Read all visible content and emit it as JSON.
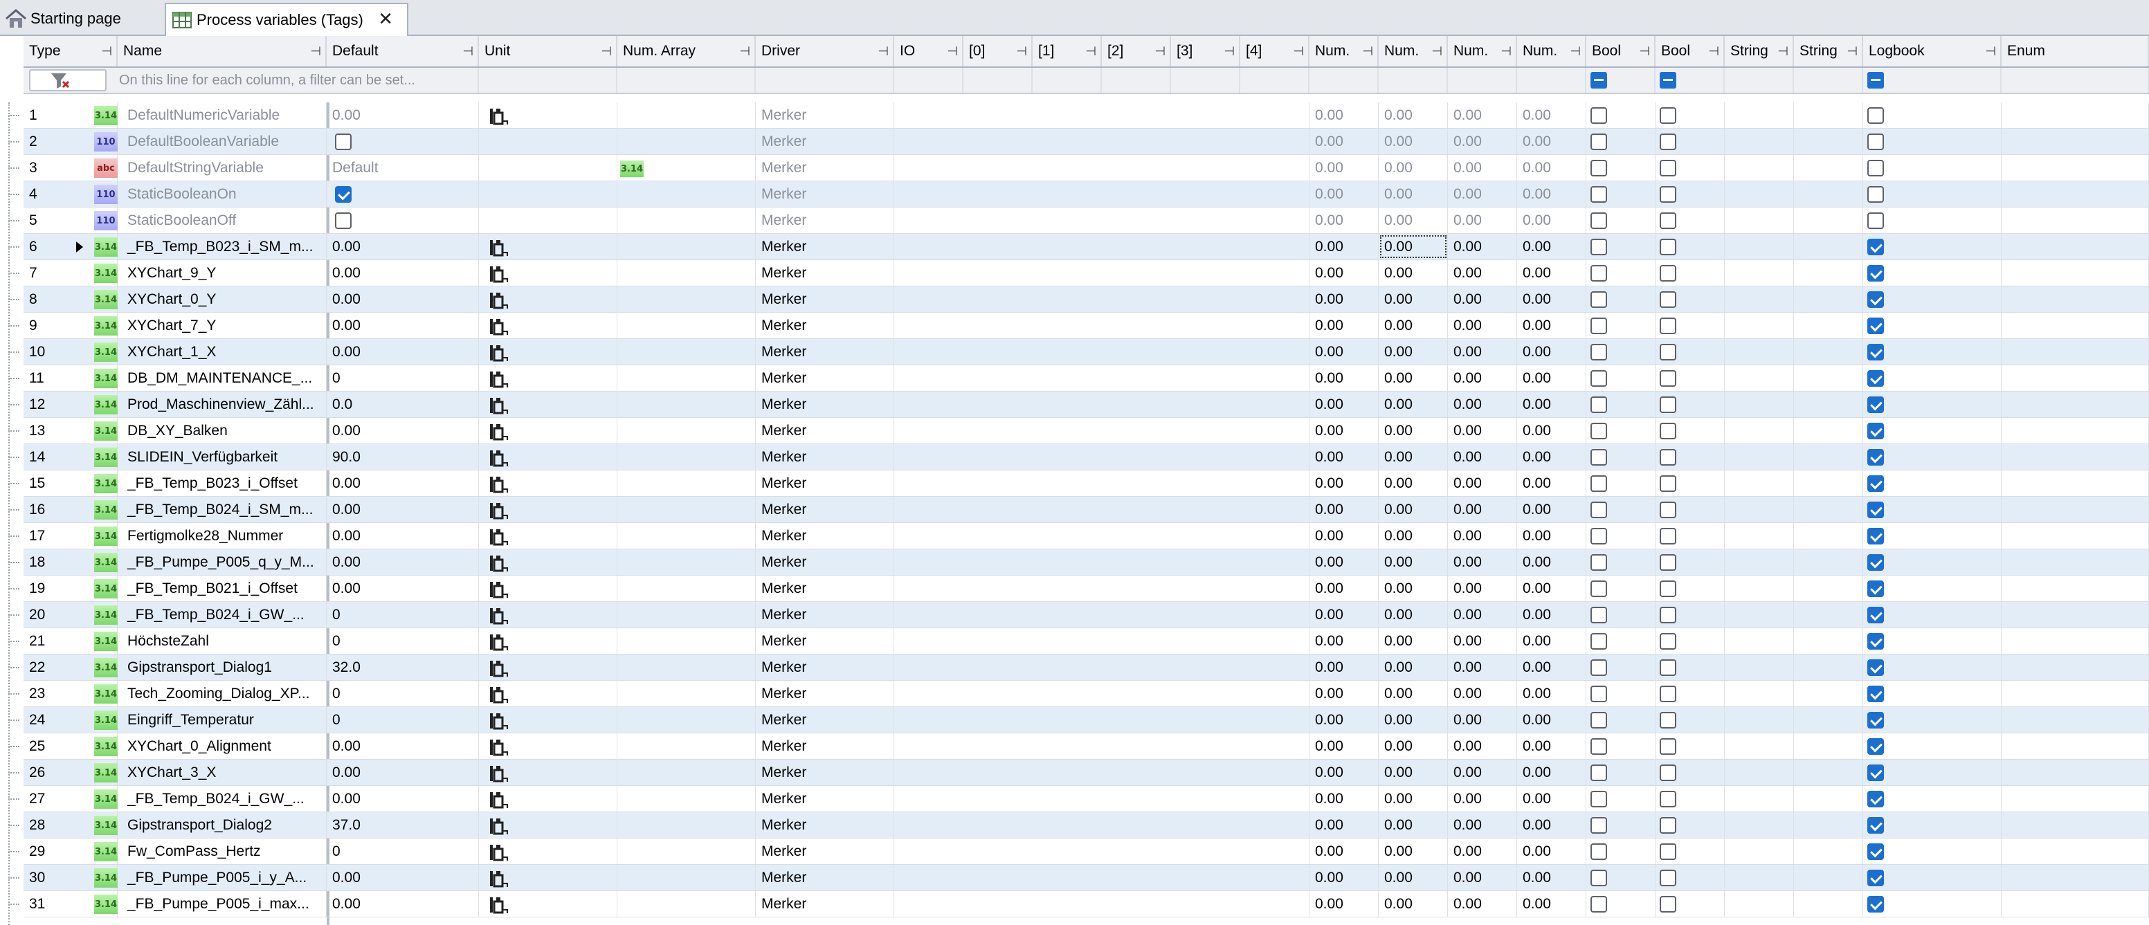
{
  "tabs": [
    {
      "label": "Starting page",
      "icon": "home-icon",
      "active": false
    },
    {
      "label": "Process variables (Tags)",
      "icon": "table-icon",
      "active": true,
      "close": "✕"
    }
  ],
  "columns": [
    {
      "key": "type",
      "label": "Type"
    },
    {
      "key": "name",
      "label": "Name"
    },
    {
      "key": "default",
      "label": "Default"
    },
    {
      "key": "unit",
      "label": "Unit"
    },
    {
      "key": "numarray",
      "label": "Num. Array"
    },
    {
      "key": "driver",
      "label": "Driver"
    },
    {
      "key": "io",
      "label": "IO"
    },
    {
      "key": "i0",
      "label": "[0]"
    },
    {
      "key": "i1",
      "label": "[1]"
    },
    {
      "key": "i2",
      "label": "[2]"
    },
    {
      "key": "i3",
      "label": "[3]"
    },
    {
      "key": "i4",
      "label": "[4]"
    },
    {
      "key": "num1",
      "label": "Num."
    },
    {
      "key": "num2",
      "label": "Num."
    },
    {
      "key": "num3",
      "label": "Num."
    },
    {
      "key": "num4",
      "label": "Num."
    },
    {
      "key": "bool1",
      "label": "Bool"
    },
    {
      "key": "bool2",
      "label": "Bool"
    },
    {
      "key": "string1",
      "label": "String"
    },
    {
      "key": "string2",
      "label": "String"
    },
    {
      "key": "logbook",
      "label": "Logbook"
    },
    {
      "key": "enum",
      "label": "Enum"
    }
  ],
  "filter_placeholder": "On this line for each column, a filter can be set...",
  "pin_glyph": "⊣",
  "rows": [
    {
      "id": "1",
      "type": "num",
      "badge": "3.14",
      "name": "DefaultNumericVariable",
      "default": "0.00",
      "unit_icon": true,
      "driver": "Merker",
      "n": [
        "0.00",
        "0.00",
        "0.00",
        "0.00"
      ],
      "b1": false,
      "b2": false,
      "log": false,
      "gray": true
    },
    {
      "id": "2",
      "type": "bool",
      "badge": "110",
      "name": "DefaultBooleanVariable",
      "default_cb": false,
      "driver": "Merker",
      "n": [
        "0.00",
        "0.00",
        "0.00",
        "0.00"
      ],
      "b1": false,
      "b2": false,
      "log": false,
      "gray": true
    },
    {
      "id": "3",
      "type": "str",
      "badge": "abc",
      "name": "DefaultStringVariable",
      "default": "Default",
      "numarray_badge": "3.14",
      "driver": "Merker",
      "n": [
        "0.00",
        "0.00",
        "0.00",
        "0.00"
      ],
      "b1": false,
      "b2": false,
      "log": false,
      "gray": true
    },
    {
      "id": "4",
      "type": "bool",
      "badge": "110",
      "name": "StaticBooleanOn",
      "default_cb": true,
      "driver": "Merker",
      "n": [
        "0.00",
        "0.00",
        "0.00",
        "0.00"
      ],
      "b1": false,
      "b2": false,
      "log": false,
      "gray": true
    },
    {
      "id": "5",
      "type": "bool",
      "badge": "110",
      "name": "StaticBooleanOff",
      "default_cb": false,
      "driver": "Merker",
      "n": [
        "0.00",
        "0.00",
        "0.00",
        "0.00"
      ],
      "b1": false,
      "b2": false,
      "log": false,
      "gray": true
    },
    {
      "id": "6",
      "type": "num",
      "badge": "3.14",
      "name": "_FB_Temp_B023_i_SM_m...",
      "default": "0.00",
      "unit_icon": true,
      "driver": "Merker",
      "n": [
        "0.00",
        "0.00",
        "0.00",
        "0.00"
      ],
      "b1": false,
      "b2": false,
      "log": true,
      "selected": true
    },
    {
      "id": "7",
      "type": "num",
      "badge": "3.14",
      "name": "XYChart_9_Y",
      "default": "0.00",
      "unit_icon": true,
      "driver": "Merker",
      "n": [
        "0.00",
        "0.00",
        "0.00",
        "0.00"
      ],
      "b1": false,
      "b2": false,
      "log": true
    },
    {
      "id": "8",
      "type": "num",
      "badge": "3.14",
      "name": "XYChart_0_Y",
      "default": "0.00",
      "unit_icon": true,
      "driver": "Merker",
      "n": [
        "0.00",
        "0.00",
        "0.00",
        "0.00"
      ],
      "b1": false,
      "b2": false,
      "log": true
    },
    {
      "id": "9",
      "type": "num",
      "badge": "3.14",
      "name": "XYChart_7_Y",
      "default": "0.00",
      "unit_icon": true,
      "driver": "Merker",
      "n": [
        "0.00",
        "0.00",
        "0.00",
        "0.00"
      ],
      "b1": false,
      "b2": false,
      "log": true
    },
    {
      "id": "10",
      "type": "num",
      "badge": "3.14",
      "name": "XYChart_1_X",
      "default": "0.00",
      "unit_icon": true,
      "driver": "Merker",
      "n": [
        "0.00",
        "0.00",
        "0.00",
        "0.00"
      ],
      "b1": false,
      "b2": false,
      "log": true
    },
    {
      "id": "11",
      "type": "num",
      "badge": "3.14",
      "name": "DB_DM_MAINTENANCE_...",
      "default": "0",
      "unit_icon": true,
      "driver": "Merker",
      "n": [
        "0.00",
        "0.00",
        "0.00",
        "0.00"
      ],
      "b1": false,
      "b2": false,
      "log": true
    },
    {
      "id": "12",
      "type": "num",
      "badge": "3.14",
      "name": "Prod_Maschinenview_Zähl...",
      "default": "0.0",
      "unit_icon": true,
      "driver": "Merker",
      "n": [
        "0.00",
        "0.00",
        "0.00",
        "0.00"
      ],
      "b1": false,
      "b2": false,
      "log": true
    },
    {
      "id": "13",
      "type": "num",
      "badge": "3.14",
      "name": "DB_XY_Balken",
      "default": "0.00",
      "unit_icon": true,
      "driver": "Merker",
      "n": [
        "0.00",
        "0.00",
        "0.00",
        "0.00"
      ],
      "b1": false,
      "b2": false,
      "log": true
    },
    {
      "id": "14",
      "type": "num",
      "badge": "3.14",
      "name": "SLIDEIN_Verfügbarkeit",
      "default": "90.0",
      "unit_icon": true,
      "driver": "Merker",
      "n": [
        "0.00",
        "0.00",
        "0.00",
        "0.00"
      ],
      "b1": false,
      "b2": false,
      "log": true
    },
    {
      "id": "15",
      "type": "num",
      "badge": "3.14",
      "name": "_FB_Temp_B023_i_Offset",
      "default": "0.00",
      "unit_icon": true,
      "driver": "Merker",
      "n": [
        "0.00",
        "0.00",
        "0.00",
        "0.00"
      ],
      "b1": false,
      "b2": false,
      "log": true
    },
    {
      "id": "16",
      "type": "num",
      "badge": "3.14",
      "name": "_FB_Temp_B024_i_SM_m...",
      "default": "0.00",
      "unit_icon": true,
      "driver": "Merker",
      "n": [
        "0.00",
        "0.00",
        "0.00",
        "0.00"
      ],
      "b1": false,
      "b2": false,
      "log": true
    },
    {
      "id": "17",
      "type": "num",
      "badge": "3.14",
      "name": "Fertigmolke28_Nummer",
      "default": "0.00",
      "unit_icon": true,
      "driver": "Merker",
      "n": [
        "0.00",
        "0.00",
        "0.00",
        "0.00"
      ],
      "b1": false,
      "b2": false,
      "log": true
    },
    {
      "id": "18",
      "type": "num",
      "badge": "3.14",
      "name": "_FB_Pumpe_P005_q_y_M...",
      "default": "0.00",
      "unit_icon": true,
      "driver": "Merker",
      "n": [
        "0.00",
        "0.00",
        "0.00",
        "0.00"
      ],
      "b1": false,
      "b2": false,
      "log": true
    },
    {
      "id": "19",
      "type": "num",
      "badge": "3.14",
      "name": "_FB_Temp_B021_i_Offset",
      "default": "0.00",
      "unit_icon": true,
      "driver": "Merker",
      "n": [
        "0.00",
        "0.00",
        "0.00",
        "0.00"
      ],
      "b1": false,
      "b2": false,
      "log": true
    },
    {
      "id": "20",
      "type": "num",
      "badge": "3.14",
      "name": "_FB_Temp_B024_i_GW_...",
      "default": "0",
      "unit_icon": true,
      "driver": "Merker",
      "n": [
        "0.00",
        "0.00",
        "0.00",
        "0.00"
      ],
      "b1": false,
      "b2": false,
      "log": true
    },
    {
      "id": "21",
      "type": "num",
      "badge": "3.14",
      "name": "HöchsteZahl",
      "default": "0",
      "unit_icon": true,
      "driver": "Merker",
      "n": [
        "0.00",
        "0.00",
        "0.00",
        "0.00"
      ],
      "b1": false,
      "b2": false,
      "log": true
    },
    {
      "id": "22",
      "type": "num",
      "badge": "3.14",
      "name": "Gipstransport_Dialog1",
      "default": "32.0",
      "unit_icon": true,
      "driver": "Merker",
      "n": [
        "0.00",
        "0.00",
        "0.00",
        "0.00"
      ],
      "b1": false,
      "b2": false,
      "log": true
    },
    {
      "id": "23",
      "type": "num",
      "badge": "3.14",
      "name": "Tech_Zooming_Dialog_XP...",
      "default": "0",
      "unit_icon": true,
      "driver": "Merker",
      "n": [
        "0.00",
        "0.00",
        "0.00",
        "0.00"
      ],
      "b1": false,
      "b2": false,
      "log": true
    },
    {
      "id": "24",
      "type": "num",
      "badge": "3.14",
      "name": "Eingriff_Temperatur",
      "default": "0",
      "unit_icon": true,
      "driver": "Merker",
      "n": [
        "0.00",
        "0.00",
        "0.00",
        "0.00"
      ],
      "b1": false,
      "b2": false,
      "log": true
    },
    {
      "id": "25",
      "type": "num",
      "badge": "3.14",
      "name": "XYChart_0_Alignment",
      "default": "0.00",
      "unit_icon": true,
      "driver": "Merker",
      "n": [
        "0.00",
        "0.00",
        "0.00",
        "0.00"
      ],
      "b1": false,
      "b2": false,
      "log": true
    },
    {
      "id": "26",
      "type": "num",
      "badge": "3.14",
      "name": "XYChart_3_X",
      "default": "0.00",
      "unit_icon": true,
      "driver": "Merker",
      "n": [
        "0.00",
        "0.00",
        "0.00",
        "0.00"
      ],
      "b1": false,
      "b2": false,
      "log": true
    },
    {
      "id": "27",
      "type": "num",
      "badge": "3.14",
      "name": "_FB_Temp_B024_i_GW_...",
      "default": "0.00",
      "unit_icon": true,
      "driver": "Merker",
      "n": [
        "0.00",
        "0.00",
        "0.00",
        "0.00"
      ],
      "b1": false,
      "b2": false,
      "log": true
    },
    {
      "id": "28",
      "type": "num",
      "badge": "3.14",
      "name": "Gipstransport_Dialog2",
      "default": "37.0",
      "unit_icon": true,
      "driver": "Merker",
      "n": [
        "0.00",
        "0.00",
        "0.00",
        "0.00"
      ],
      "b1": false,
      "b2": false,
      "log": true
    },
    {
      "id": "29",
      "type": "num",
      "badge": "3.14",
      "name": "Fw_ComPass_Hertz",
      "default": "0",
      "unit_icon": true,
      "driver": "Merker",
      "n": [
        "0.00",
        "0.00",
        "0.00",
        "0.00"
      ],
      "b1": false,
      "b2": false,
      "log": true
    },
    {
      "id": "30",
      "type": "num",
      "badge": "3.14",
      "name": "_FB_Pumpe_P005_i_y_A...",
      "default": "0.00",
      "unit_icon": true,
      "driver": "Merker",
      "n": [
        "0.00",
        "0.00",
        "0.00",
        "0.00"
      ],
      "b1": false,
      "b2": false,
      "log": true
    },
    {
      "id": "31",
      "type": "num",
      "badge": "3.14",
      "name": "_FB_Pumpe_P005_i_max...",
      "default": "0.00",
      "unit_icon": true,
      "driver": "Merker",
      "n": [
        "0.00",
        "0.00",
        "0.00",
        "0.00"
      ],
      "b1": false,
      "b2": false,
      "log": true
    }
  ],
  "colors": {
    "accent": "#1b6fd1",
    "row_alt": "#e3edf8",
    "header_bg": "#f0f1f4"
  }
}
